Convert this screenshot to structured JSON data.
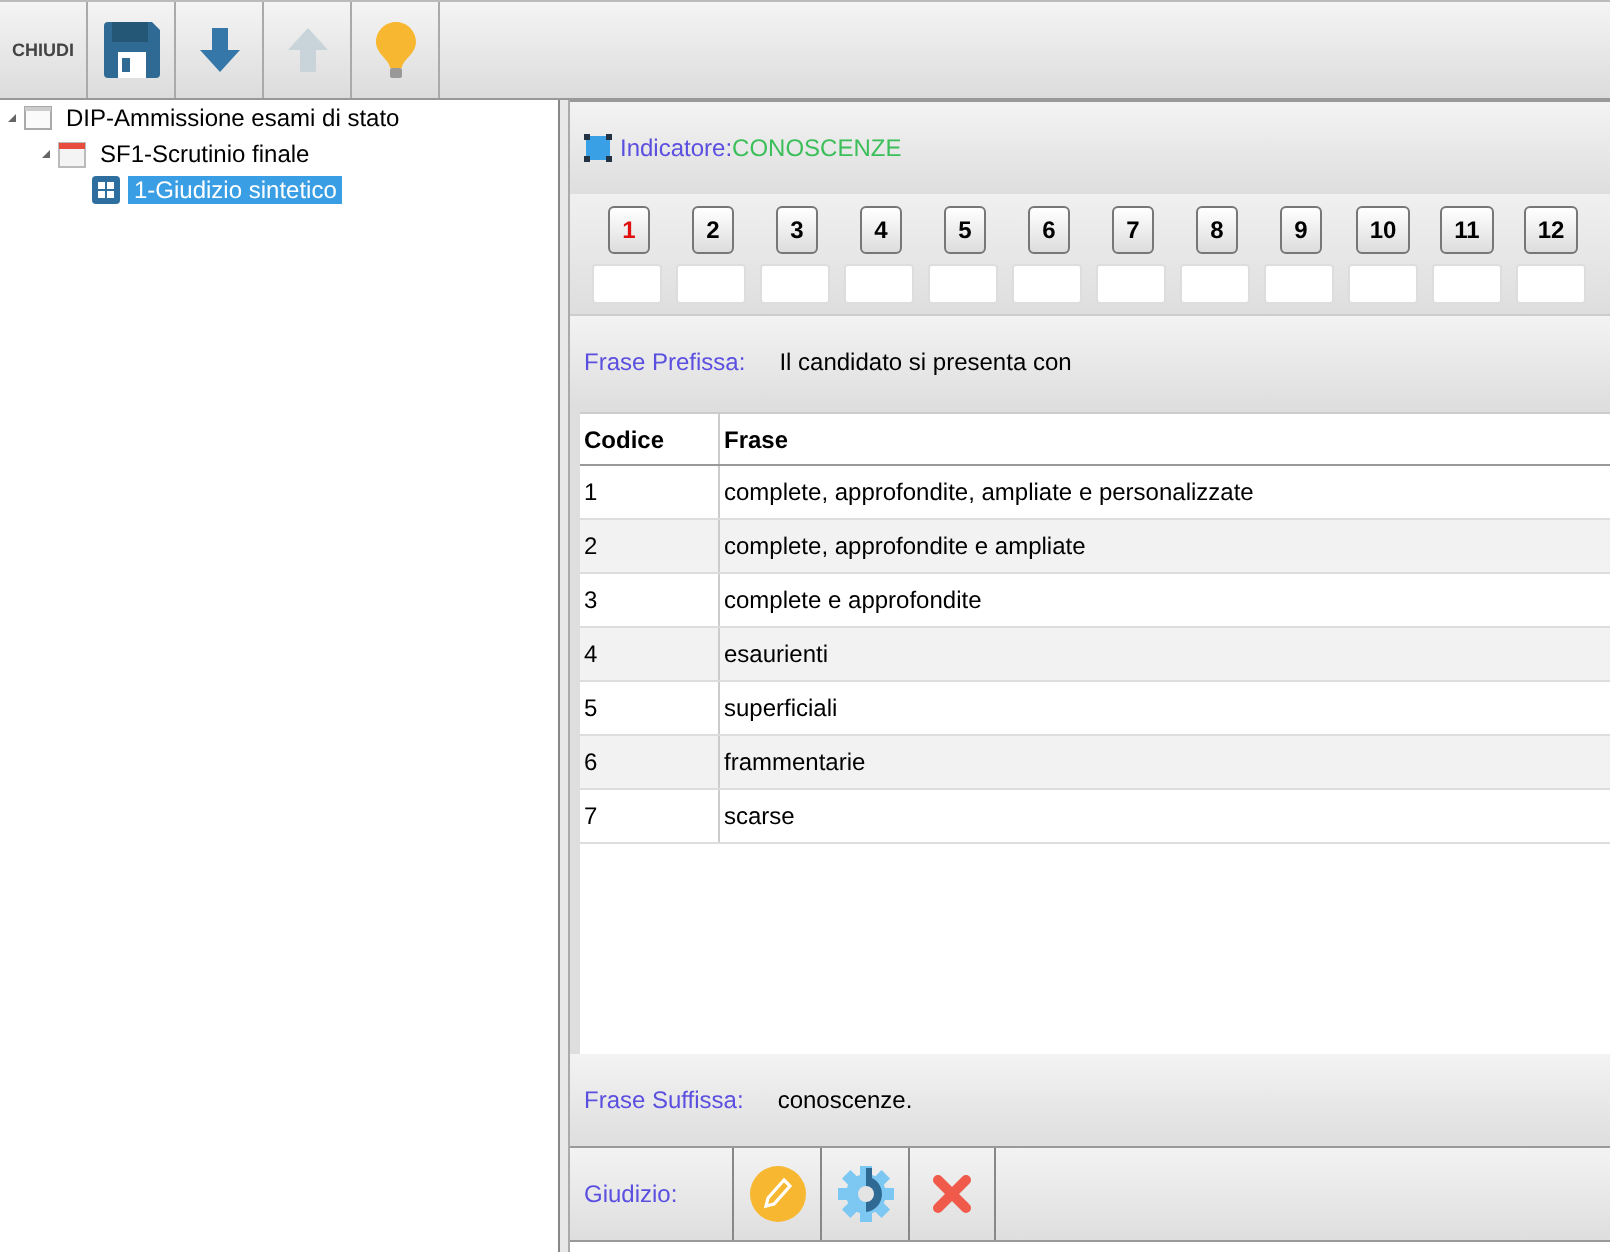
{
  "toolbar": {
    "close_label": "CHIUDI"
  },
  "tree": [
    {
      "label": "DIP-Ammissione esami di stato",
      "kind": "document",
      "selected": false,
      "children": [
        {
          "label": "SF1-Scrutinio finale",
          "kind": "calendar",
          "selected": false,
          "children": [
            {
              "label": "1-Giudizio sintetico",
              "kind": "grid",
              "selected": true
            }
          ]
        }
      ]
    }
  ],
  "indicator": {
    "label": "Indicatore:",
    "value": "CONOSCENZE"
  },
  "levels": [
    {
      "label": "1",
      "selected": true
    },
    {
      "label": "2",
      "selected": false
    },
    {
      "label": "3",
      "selected": false
    },
    {
      "label": "4",
      "selected": false
    },
    {
      "label": "5",
      "selected": false
    },
    {
      "label": "6",
      "selected": false
    },
    {
      "label": "7",
      "selected": false
    },
    {
      "label": "8",
      "selected": false
    },
    {
      "label": "9",
      "selected": false
    },
    {
      "label": "10",
      "selected": false
    },
    {
      "label": "11",
      "selected": false
    },
    {
      "label": "12",
      "selected": false
    }
  ],
  "prefix": {
    "label": "Frase Prefissa:",
    "value": "Il candidato si presenta con"
  },
  "table": {
    "columns": [
      "Codice",
      "Frase"
    ],
    "rows": [
      [
        "1",
        "complete, approfondite, ampliate e personalizzate"
      ],
      [
        "2",
        "complete, approfondite e ampliate"
      ],
      [
        "3",
        "complete e approfondite"
      ],
      [
        "4",
        "esaurienti"
      ],
      [
        "5",
        "superficiali"
      ],
      [
        "6",
        "frammentarie"
      ],
      [
        "7",
        "scarse"
      ]
    ]
  },
  "suffix": {
    "label": "Frase Suffissa:",
    "value": "conoscenze."
  },
  "judgement": {
    "label": "Giudizio:"
  }
}
